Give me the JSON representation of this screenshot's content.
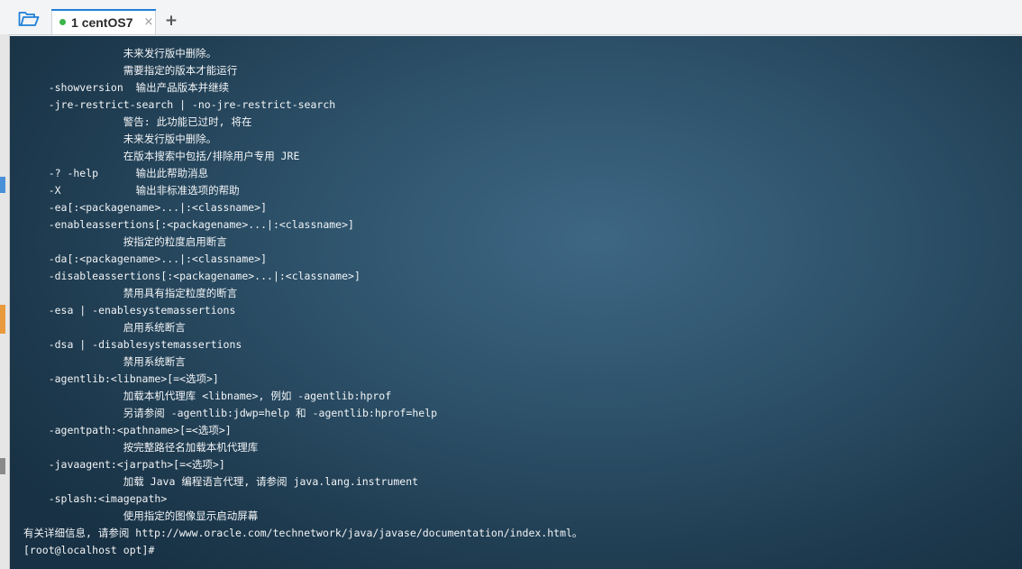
{
  "tabbar": {
    "tabs": [
      {
        "number": "1",
        "title": "centOS7",
        "close": "×",
        "status_color": "#3ab54a"
      }
    ],
    "new_tab_label": "+"
  },
  "terminal": {
    "lines": [
      "                未来发行版中删除。",
      "                需要指定的版本才能运行",
      "    -showversion  输出产品版本并继续",
      "    -jre-restrict-search | -no-jre-restrict-search",
      "                警告: 此功能已过时, 将在",
      "                未来发行版中删除。",
      "                在版本搜索中包括/排除用户专用 JRE",
      "    -? -help      输出此帮助消息",
      "    -X            输出非标准选项的帮助",
      "    -ea[:<packagename>...|:<classname>]",
      "    -enableassertions[:<packagename>...|:<classname>]",
      "                按指定的粒度启用断言",
      "    -da[:<packagename>...|:<classname>]",
      "    -disableassertions[:<packagename>...|:<classname>]",
      "                禁用具有指定粒度的断言",
      "    -esa | -enablesystemassertions",
      "                启用系统断言",
      "    -dsa | -disablesystemassertions",
      "                禁用系统断言",
      "    -agentlib:<libname>[=<选项>]",
      "                加载本机代理库 <libname>, 例如 -agentlib:hprof",
      "                另请参阅 -agentlib:jdwp=help 和 -agentlib:hprof=help",
      "    -agentpath:<pathname>[=<选项>]",
      "                按完整路径名加载本机代理库",
      "    -javaagent:<jarpath>[=<选项>]",
      "                加载 Java 编程语言代理, 请参阅 java.lang.instrument",
      "    -splash:<imagepath>",
      "                使用指定的图像显示启动屏幕",
      "有关详细信息, 请参阅 http://www.oracle.com/technetwork/java/javase/documentation/index.html。",
      "[root@localhost opt]#"
    ]
  },
  "colors": {
    "accent": "#1e7fd8",
    "terminal_text": "#f2f4f6",
    "terminal_bg": "#2c5068"
  }
}
